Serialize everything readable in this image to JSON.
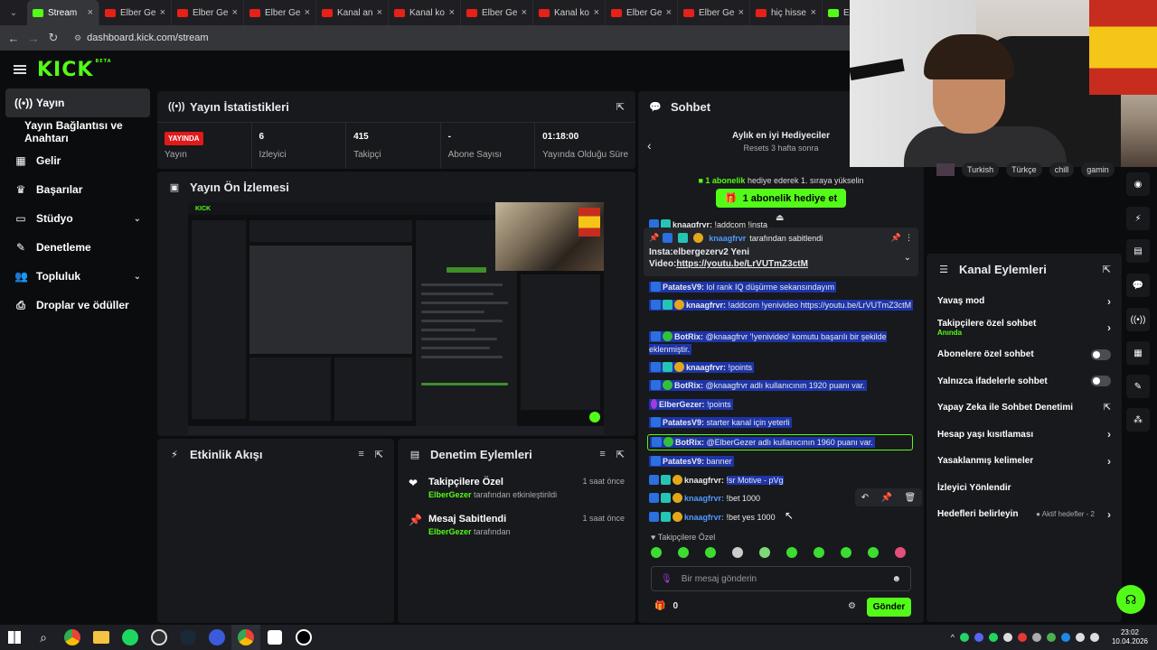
{
  "browser": {
    "tabs": [
      {
        "label": "Stream",
        "type": "kick",
        "active": true
      },
      {
        "label": "Elber Ge",
        "type": "yt"
      },
      {
        "label": "Elber Ge",
        "type": "yt"
      },
      {
        "label": "Elber Ge",
        "type": "yt"
      },
      {
        "label": "Kanal an",
        "type": "yt"
      },
      {
        "label": "Kanal ko",
        "type": "yt"
      },
      {
        "label": "Elber Ge",
        "type": "yt"
      },
      {
        "label": "Kanal ko",
        "type": "yt"
      },
      {
        "label": "Elber Ge",
        "type": "yt"
      },
      {
        "label": "Elber Ge",
        "type": "yt"
      },
      {
        "label": "hiç hisse",
        "type": "yt"
      },
      {
        "label": "ElberGe",
        "type": "kick"
      }
    ],
    "url": "dashboard.kick.com/stream"
  },
  "brand": {
    "logo": "KICK",
    "beta": "BETA",
    "accent": "#53fc18"
  },
  "sidebar": {
    "items": [
      {
        "label": "Yayın",
        "icon": "broadcast-icon",
        "glyph": "((•))",
        "active": true
      },
      {
        "label": "Yayın Bağlantısı ve Anahtarı",
        "icon": "",
        "glyph": "",
        "sub": true
      },
      {
        "label": "Gelir",
        "icon": "money-icon",
        "glyph": "▦"
      },
      {
        "label": "Başarılar",
        "icon": "trophy-icon",
        "glyph": "♛"
      },
      {
        "label": "Stüdyo",
        "icon": "studio-icon",
        "glyph": "▭",
        "chevron": "⌄"
      },
      {
        "label": "Denetleme",
        "icon": "wrench-icon",
        "glyph": "✎"
      },
      {
        "label": "Topluluk",
        "icon": "community-icon",
        "glyph": "👥",
        "chevron": "⌄"
      },
      {
        "label": "Droplar ve ödüller",
        "icon": "drops-icon",
        "glyph": "⎙"
      }
    ]
  },
  "stats": {
    "title": "Yayın İstatistikleri",
    "live_badge": "YAYINDA",
    "items": [
      {
        "value": "",
        "label": "Yayın"
      },
      {
        "value": "6",
        "label": "İzleyici"
      },
      {
        "value": "415",
        "label": "Takipçi"
      },
      {
        "value": "-",
        "label": "Abone Sayısı"
      },
      {
        "value": "01:18:00",
        "label": "Yayında Olduğu Süre"
      }
    ]
  },
  "preview": {
    "title": "Yayın Ön İzlemesi"
  },
  "activity": {
    "title": "Etkinlik Akışı"
  },
  "moderation": {
    "title": "Denetim Eylemleri",
    "items": [
      {
        "title": "Takipçilere Özel",
        "user": "ElberGezer",
        "suffix": "tarafından etkinleştirildi",
        "time": "1 saat önce",
        "icon": "heart-icon",
        "glyph": "❤"
      },
      {
        "title": "Mesaj Sabitlendi",
        "user": "ElberGezer",
        "suffix": "tarafından",
        "time": "1 saat önce",
        "icon": "pin-icon",
        "glyph": "📌"
      }
    ]
  },
  "chat": {
    "title": "Sohbet",
    "gifters_title": "Aylık en iyi Hediyeciler",
    "gifters_sub": "Resets 3 hafta sonra",
    "gift_prompt_bold": "1 abonelik",
    "gift_prompt_rest": "hediye ederek 1. sıraya yükselin",
    "gift_button": "1 abonelik hediye et",
    "pinned_by_user": "knaagfrvr",
    "pinned_by_suffix": "tarafından sabitlendi",
    "pinned_text": "Insta:elbergezerv2 Yeni Video:",
    "pinned_link": "https://youtu.be/LrVUTmZ3ctM",
    "partial_user": "knaagfrvr:",
    "partial_text": "!addcom !insta",
    "messages": [
      {
        "user": "PatatesV9:",
        "text": "lol rank IQ düşürme sekansındayım",
        "hl": true,
        "badges": "b"
      },
      {
        "user": "knaagfrvr:",
        "text": "!addcom !yenivideo https://youtu.be/LrVUTmZ3ctM",
        "hl": true,
        "badges": "bgc"
      },
      {
        "user": "BotRix:",
        "text": "@knaagfrvr '!yenivideo' komutu başarılı bir şekilde eklenmiştir.",
        "hl": true,
        "badges": "bv"
      },
      {
        "user": "knaagfrvr:",
        "text": "!points",
        "hl": true,
        "badges": "bgc"
      },
      {
        "user": "BotRix:",
        "text": "@knaagfrvr adlı kullanıcının 1920 puanı var.",
        "hl": true,
        "badges": "bv"
      },
      {
        "user": "ElberGezer:",
        "text": "!points",
        "hl": true,
        "badges": "m"
      },
      {
        "user": "PatatesV9:",
        "text": "starter kanal için yeterli",
        "hl": true,
        "badges": "b"
      },
      {
        "user": "BotRix:",
        "text": "@ElberGezer adlı kullanıcının 1960 puanı var.",
        "hl": true,
        "badges": "bv",
        "outlined": true
      },
      {
        "user": "PatatesV9:",
        "text": "banner",
        "hl": true,
        "badges": "b"
      },
      {
        "user": "knaagfrvr:",
        "text": "!sr Motive - pVg",
        "hl": false,
        "partial_hl": true,
        "badges": "bgc"
      },
      {
        "user": "knaagfrvr:",
        "text": "!bet 1000",
        "hl": false,
        "blue": true,
        "badges": "bgc"
      },
      {
        "user": "knaagfrvr:",
        "text": "!bet yes 1000",
        "hl": false,
        "blue": true,
        "badges": "bgc"
      }
    ],
    "followers_only": "Takipçilere Özel",
    "input_placeholder": "Bir mesaj gönderin",
    "points": "0",
    "send": "Gönder"
  },
  "stream_tags": [
    "Turkish",
    "Türkçe",
    "chill",
    "gamin"
  ],
  "channel_actions": {
    "title": "Kanal Eylemleri",
    "items": [
      {
        "label": "Yavaş mod",
        "control": "chevron"
      },
      {
        "label": "Takipçilere özel sohbet",
        "sub": "Anında",
        "control": "chevron"
      },
      {
        "label": "Abonelere özel sohbet",
        "control": "toggle"
      },
      {
        "label": "Yalnızca ifadelerle sohbet",
        "control": "toggle"
      },
      {
        "label": "Yapay Zeka ile Sohbet Denetimi",
        "control": "external"
      },
      {
        "label": "Hesap yaşı kısıtlaması",
        "control": "chevron"
      },
      {
        "label": "Yasaklanmış kelimeler",
        "control": "chevron"
      },
      {
        "label": "İzleyici Yönlendir",
        "control": "none"
      },
      {
        "label": "Hedefleri belirleyin",
        "control": "chevron",
        "extra": "Aktif hedefler - 2"
      }
    ]
  },
  "taskbar": {
    "time": "23:02",
    "date": "10.04.2026"
  }
}
